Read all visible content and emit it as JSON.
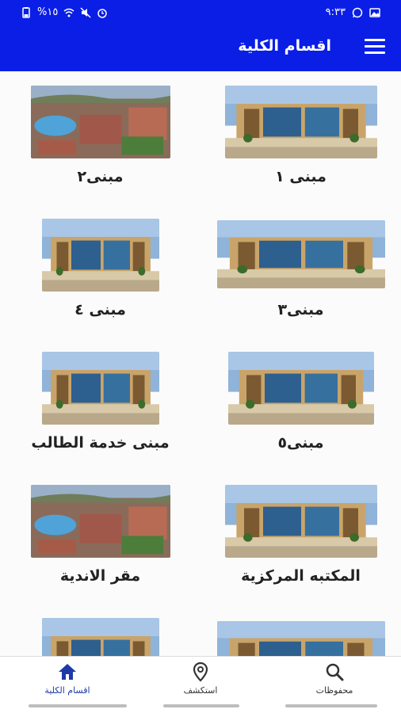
{
  "status_bar": {
    "time": "٩:٣٣",
    "battery": "%١٥"
  },
  "app_bar": {
    "title": "اقسام الكلية"
  },
  "colors": {
    "primary": "#0a1ee6",
    "active_nav": "#1e3aa8"
  },
  "cards": [
    {
      "label": "مبنى ١",
      "image": "building-photo"
    },
    {
      "label": "مبنى٢",
      "image": "campus-aerial-photo"
    },
    {
      "label": "مبنى٣",
      "image": "building-photo"
    },
    {
      "label": "مبنى ٤",
      "image": "building-photo"
    },
    {
      "label": "مبنى٥",
      "image": "building-photo"
    },
    {
      "label": "مبنى خدمة الطالب",
      "image": "building-photo"
    },
    {
      "label": "المكتبه المركزية",
      "image": "building-photo"
    },
    {
      "label": "مقر الاندية",
      "image": "campus-aerial-photo"
    },
    {
      "label": "",
      "image": "building-photo"
    },
    {
      "label": "",
      "image": "building-photo"
    }
  ],
  "bottom_nav": [
    {
      "label": "محفوظات",
      "icon": "search-icon"
    },
    {
      "label": "استكشف",
      "icon": "location-pin-icon"
    },
    {
      "label": "اقسام الكلية",
      "icon": "home-icon",
      "active": true
    }
  ]
}
